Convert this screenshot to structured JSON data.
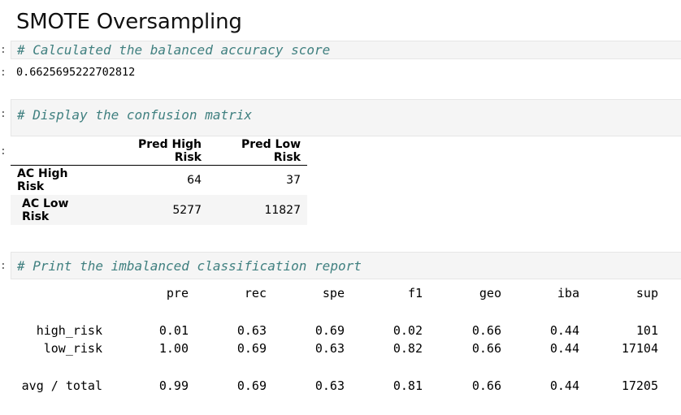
{
  "title": "SMOTE Oversampling",
  "cells": [
    {
      "prompt": ":",
      "code": "# Calculated the balanced accuracy score",
      "output": "0.6625695222702812"
    },
    {
      "prompt": ":",
      "code": "# Display the confusion matrix"
    },
    {
      "prompt": ":",
      "code": "# Print the imbalanced classification report"
    }
  ],
  "output_prompts": [
    ":",
    ":"
  ],
  "confusion_matrix": {
    "columns": [
      "",
      "Pred High Risk",
      "Pred Low Risk"
    ],
    "rows": [
      {
        "label": "AC High Risk",
        "values": [
          "64",
          "37"
        ]
      },
      {
        "label": "AC Low Risk",
        "values": [
          "5277",
          "11827"
        ]
      }
    ]
  },
  "report": {
    "headers": [
      "pre",
      "rec",
      "spe",
      "f1",
      "geo",
      "iba",
      "sup"
    ],
    "rows": [
      {
        "label": "high_risk",
        "values": [
          "0.01",
          "0.63",
          "0.69",
          "0.02",
          "0.66",
          "0.44",
          "101"
        ]
      },
      {
        "label": "low_risk",
        "values": [
          "1.00",
          "0.69",
          "0.63",
          "0.82",
          "0.66",
          "0.44",
          "17104"
        ]
      },
      {
        "label": "avg / total",
        "values": [
          "0.99",
          "0.69",
          "0.63",
          "0.81",
          "0.66",
          "0.44",
          "17205"
        ]
      }
    ]
  }
}
